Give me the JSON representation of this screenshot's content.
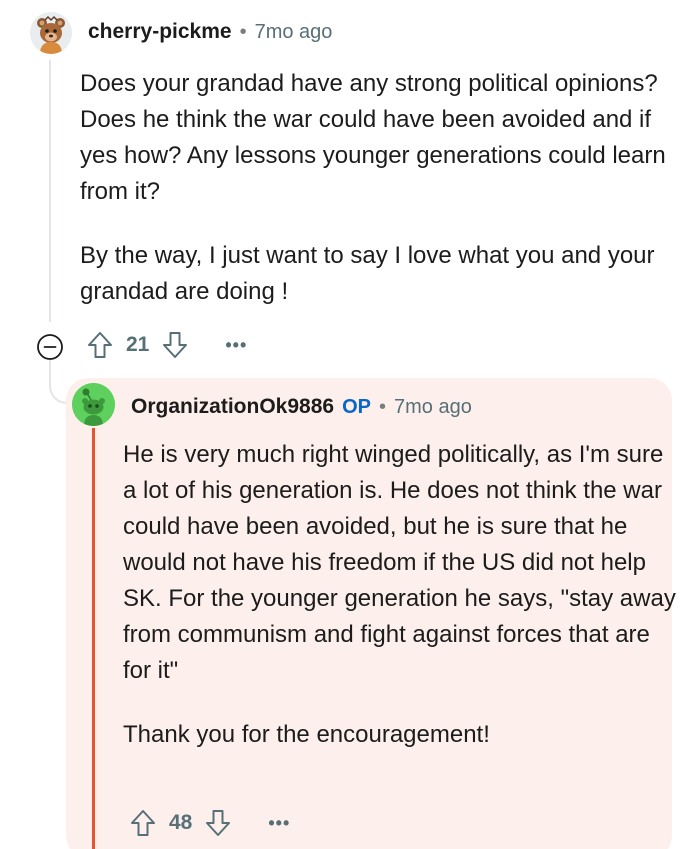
{
  "comment": {
    "username": "cherry-pickme",
    "separator": "•",
    "time": "7mo ago",
    "paragraphs": [
      "Does your grandad have any strong political opinions? Does he think the war could have been avoided and if yes how? Any lessons younger generations could learn from it?",
      "By the way, I just want to say I love what you and your grandad are doing !"
    ],
    "score": "21",
    "more": "•••"
  },
  "reply": {
    "username": "OrganizationOk9886",
    "op_badge": "OP",
    "separator": "•",
    "time": "7mo ago",
    "paragraphs": [
      "He is very much right winged politically, as I'm sure a lot of his generation is. He does not think the war could have been avoided, but he is sure that he would not have his freedom if the US did not help SK. For the younger generation he says, \"stay away from communism and fight against forces that are for it\"",
      "Thank you for the encouragement!"
    ],
    "score": "48",
    "more": "•••"
  },
  "icons": {
    "upvote": "arrow-up-outline",
    "downvote": "arrow-down-outline",
    "collapse": "circle-minus",
    "avatar_1": "snoo-bear-avatar",
    "avatar_2": "snoo-green-avatar"
  },
  "colors": {
    "op_badge": "#0a66c8",
    "highlight_bg": "#fdf0ec",
    "highlight_bar": "#e4572e",
    "meta_gray": "#576f76"
  }
}
